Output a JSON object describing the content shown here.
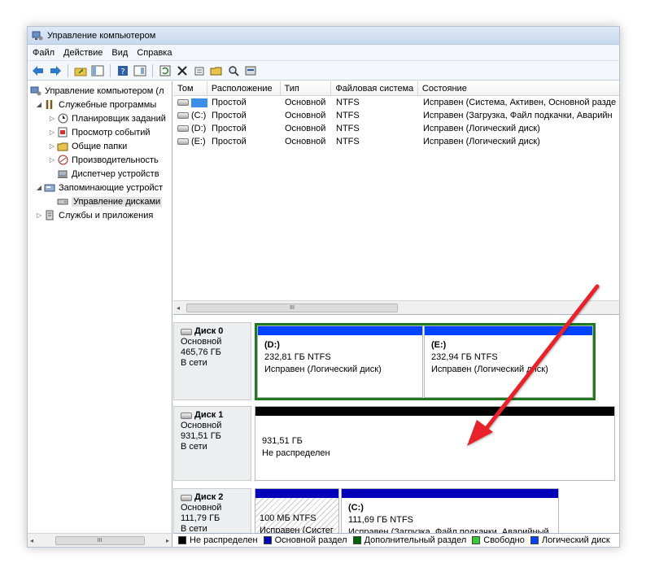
{
  "window": {
    "title": "Управление компьютером"
  },
  "menu": [
    "Файл",
    "Действие",
    "Вид",
    "Справка"
  ],
  "toolbar": {
    "icons": [
      "back-arrow-icon",
      "forward-arrow-icon",
      "up-folder-icon",
      "show-hide-tree-icon",
      "help-icon",
      "properties-icon",
      "refresh-icon",
      "delete-icon",
      "settings-icon",
      "open-folder-icon",
      "search-icon",
      "wizard-icon"
    ]
  },
  "tree": {
    "items": [
      {
        "label": "Управление компьютером (л",
        "twisty": "",
        "icon": "computer-management-icon"
      },
      {
        "label": "Служебные программы",
        "twisty": "◢",
        "icon": "tools-icon"
      },
      {
        "label": "Планировщик заданий",
        "twisty": "▷",
        "icon": "clock-icon"
      },
      {
        "label": "Просмотр событий",
        "twisty": "▷",
        "icon": "event-viewer-icon"
      },
      {
        "label": "Общие папки",
        "twisty": "▷",
        "icon": "shared-folder-icon"
      },
      {
        "label": "Производительность",
        "twisty": "▷",
        "icon": "performance-icon"
      },
      {
        "label": "Диспетчер устройств",
        "twisty": "",
        "icon": "device-manager-icon"
      },
      {
        "label": "Запоминающие устройст",
        "twisty": "◢",
        "icon": "storage-icon"
      },
      {
        "label": "Управление дисками",
        "twisty": "",
        "icon": "disk-management-icon"
      },
      {
        "label": "Службы и приложения",
        "twisty": "▷",
        "icon": "services-icon"
      }
    ],
    "scroll_thumb": "III"
  },
  "volumes": {
    "columns": [
      "Том",
      "Расположение",
      "Тип",
      "Файловая система",
      "Состояние"
    ],
    "rows": [
      [
        "",
        "Простой",
        "Основной",
        "NTFS",
        "Исправен (Система, Активен, Основной разде"
      ],
      [
        "(C:)",
        "Простой",
        "Основной",
        "NTFS",
        "Исправен (Загрузка, Файл подкачки, Аварийн"
      ],
      [
        "(D:)",
        "Простой",
        "Основной",
        "NTFS",
        "Исправен (Логический диск)"
      ],
      [
        "(E:)",
        "Простой",
        "Основной",
        "NTFS",
        "Исправен (Логический диск)"
      ]
    ],
    "scroll_thumb": "III"
  },
  "disks": [
    {
      "name": "Диск 0",
      "type": "Основной",
      "size": "465,76 ГБ",
      "status": "В сети",
      "partitions": [
        {
          "name": "(D:)",
          "size": "232,81 ГБ NTFS",
          "status": "Исправен (Логический диск)"
        },
        {
          "name": "(E:)",
          "size": "232,94 ГБ NTFS",
          "status": "Исправен (Логический диск)"
        }
      ]
    },
    {
      "name": "Диск 1",
      "type": "Основной",
      "size": "931,51 ГБ",
      "status": "В сети",
      "partitions": [
        {
          "name": "",
          "size": "931,51 ГБ",
          "status": "Не распределен"
        }
      ]
    },
    {
      "name": "Диск 2",
      "type": "Основной",
      "size": "111,79 ГБ",
      "status": "В сети",
      "partitions": [
        {
          "name": "",
          "size": "100 МБ NTFS",
          "status": "Исправен (Систег"
        },
        {
          "name": "(C:)",
          "size": "111,69 ГБ NTFS",
          "status": "Исправен (Загрузка, Файл подкачки, Аварийный"
        }
      ]
    }
  ],
  "legend": [
    {
      "label": "Не распределен",
      "color": "#000000"
    },
    {
      "label": "Основной раздел",
      "color": "#0000b8"
    },
    {
      "label": "Дополнительный раздел",
      "color": "#006400"
    },
    {
      "label": "Свободно",
      "color": "#33cc33"
    },
    {
      "label": "Логический диск",
      "color": "#0044ff"
    }
  ],
  "colors": {
    "primary": "#0000b8",
    "logical": "#0044ff",
    "extended": "#1f7a1f",
    "unallocated": "#000000",
    "arrow": "#e8202a"
  }
}
